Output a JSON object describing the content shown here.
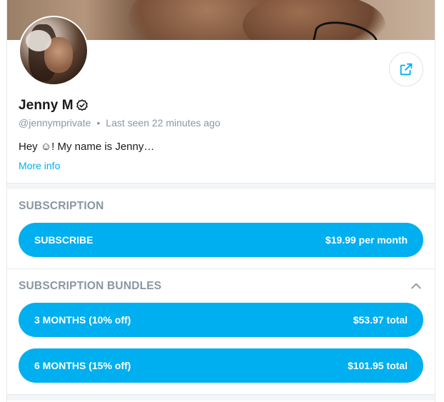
{
  "profile": {
    "name": "Jenny M",
    "handle": "@jennymprivate",
    "separator": "•",
    "last_seen": "Last seen 22 minutes ago",
    "bio": "Hey ☺! My name is Jenny…",
    "more_info": "More info"
  },
  "subscription": {
    "title": "SUBSCRIPTION",
    "button": {
      "label": "SUBSCRIBE",
      "price": "$19.99 per month"
    }
  },
  "bundles": {
    "title": "SUBSCRIPTION BUNDLES",
    "items": [
      {
        "label": "3 MONTHS (10% off)",
        "price": "$53.97 total"
      },
      {
        "label": "6 MONTHS (15% off)",
        "price": "$101.95 total"
      }
    ]
  },
  "icons": {
    "verified": "verified-badge-icon",
    "share": "share-icon",
    "collapse": "chevron-up-icon"
  },
  "colors": {
    "accent": "#00aff0",
    "muted": "#8a96a3",
    "text": "#1a1a1a"
  }
}
